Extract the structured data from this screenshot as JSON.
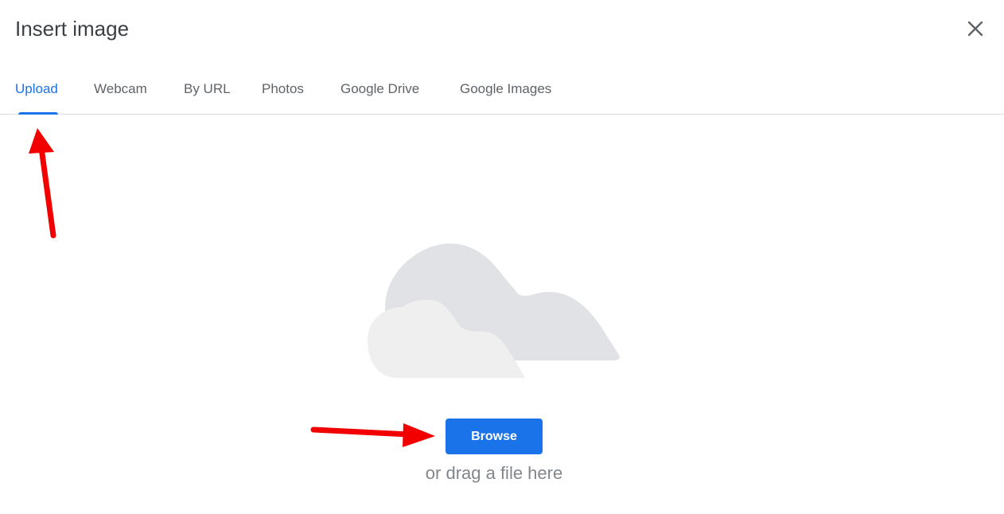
{
  "dialog": {
    "title": "Insert image",
    "close_icon": "close-icon"
  },
  "tabs": [
    {
      "label": "Upload",
      "active": true
    },
    {
      "label": "Webcam",
      "active": false
    },
    {
      "label": "By URL",
      "active": false
    },
    {
      "label": "Photos",
      "active": false
    },
    {
      "label": "Google Drive",
      "active": false
    },
    {
      "label": "Google Images",
      "active": false
    }
  ],
  "upload": {
    "illustration_icon": "cloud-icon",
    "browse_label": "Browse",
    "drag_text": "or drag a file here"
  },
  "colors": {
    "accent": "#1a73e8",
    "annotation_arrow": "#f20000",
    "text_primary": "#3c4043",
    "text_secondary": "#5f6368"
  }
}
